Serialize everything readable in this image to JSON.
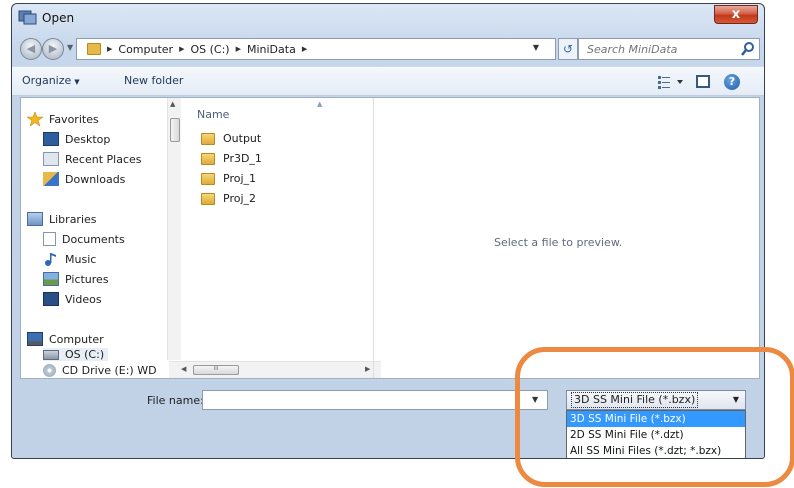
{
  "window": {
    "title": "Open",
    "close_glyph": "x"
  },
  "address": {
    "breadcrumbs": [
      "Computer",
      "OS (C:)",
      "MiniData"
    ],
    "search_placeholder": "Search MiniData"
  },
  "toolbar": {
    "organize_label": "Organize",
    "new_folder_label": "New folder",
    "help_glyph": "?"
  },
  "nav": {
    "favorites": {
      "label": "Favorites",
      "items": [
        "Desktop",
        "Recent Places",
        "Downloads"
      ]
    },
    "libraries": {
      "label": "Libraries",
      "items": [
        "Documents",
        "Music",
        "Pictures",
        "Videos"
      ]
    },
    "computer": {
      "label": "Computer",
      "items": [
        "OS (C:)",
        "CD Drive (E:) WD"
      ]
    }
  },
  "filelist": {
    "column_name": "Name",
    "items": [
      "Output",
      "Pr3D_1",
      "Proj_1",
      "Proj_2"
    ],
    "scroll_thumb_glyph": "III"
  },
  "preview": {
    "message": "Select a file to preview."
  },
  "bottom": {
    "file_name_label": "File name:",
    "file_name_value": "",
    "filter_selected": "3D SS Mini File (*.bzx)",
    "filter_options": [
      "3D SS Mini File (*.bzx)",
      "2D SS Mini File (*.dzt)",
      "All SS Mini Files (*.dzt; *.bzx)"
    ]
  },
  "colors": {
    "highlight": "#eb8a40",
    "selection": "#3399ff",
    "close_button": "#c2381a"
  }
}
